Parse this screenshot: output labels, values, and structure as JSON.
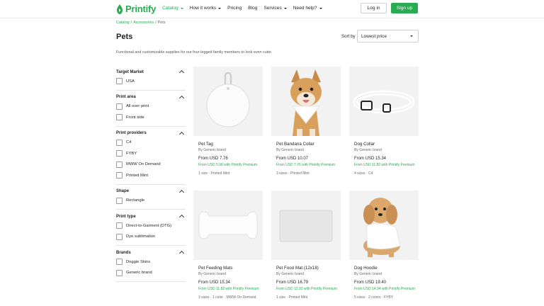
{
  "header": {
    "logo_text": "Printify",
    "nav": [
      {
        "label": "Catalog",
        "has_caret": true,
        "active": true
      },
      {
        "label": "How it works",
        "has_caret": true,
        "active": false
      },
      {
        "label": "Pricing",
        "has_caret": false,
        "active": false
      },
      {
        "label": "Blog",
        "has_caret": false,
        "active": false
      },
      {
        "label": "Services",
        "has_caret": true,
        "active": false
      },
      {
        "label": "Need help?",
        "has_caret": true,
        "active": false
      }
    ],
    "login_label": "Log in",
    "signup_label": "Sign up"
  },
  "breadcrumb": {
    "items": [
      "Catalog",
      "Accessories",
      "Pets"
    ],
    "separator": "/"
  },
  "page": {
    "title": "Pets",
    "description": "Functional and customizable supplies for our four-legged family members to look even cuter.",
    "sort_label": "Sort by",
    "sort_value": "Lowest price"
  },
  "filters": [
    {
      "title": "Target Market",
      "options": [
        "USA"
      ]
    },
    {
      "title": "Print area",
      "options": [
        "All over print",
        "Front side"
      ]
    },
    {
      "title": "Print providers",
      "options": [
        "C4",
        "FYBY",
        "MWW On Demand",
        "Printed Mint"
      ]
    },
    {
      "title": "Shape",
      "options": [
        "Rectangle"
      ]
    },
    {
      "title": "Print type",
      "options": [
        "Direct-to-Garment (DTG)",
        "Dye sublimation"
      ]
    },
    {
      "title": "Brands",
      "options": [
        "Doggie Skins",
        "Generic brand"
      ]
    }
  ],
  "products": [
    {
      "name": "Pet Tag",
      "brand": "By Generic brand",
      "price": "From USD 7.76",
      "premium": "From USD 5.98 with Printify Premium",
      "meta": "1 size · Printed Mint",
      "image_icon": "pet-tag"
    },
    {
      "name": "Pet Bandana Collar",
      "brand": "By Generic brand",
      "price": "From USD 10.07",
      "premium": "From USD 7.76 with Printify Premium",
      "meta": "3 sizes · Printed Mint",
      "image_icon": "dog-bandana"
    },
    {
      "name": "Dog Collar",
      "brand": "By Generic brand",
      "price": "From USD 15.34",
      "premium": "From USD 11.82 with Printify Premium",
      "meta": "4 sizes · C4",
      "image_icon": "dog-collar"
    },
    {
      "name": "Pet Feeding Mats",
      "brand": "By Generic brand",
      "price": "From USD 15.34",
      "premium": "From USD 11.82 with Printify Premium",
      "meta": "3 sizes · 1 color · MWW On Demand",
      "image_icon": "bone-mat"
    },
    {
      "name": "Pet Food Mat (12x18)",
      "brand": "By Generic brand",
      "price": "From USD 16.79",
      "premium": "From USD 12.93 with Printify Premium",
      "meta": "1 size · Printed Mint",
      "image_icon": "food-mat"
    },
    {
      "name": "Dog Hoodie",
      "brand": "By Generic brand",
      "price": "From USD 19.40",
      "premium": "From USD 14.94 with Printify Premium",
      "meta": "5 sizes · 2 colors · FYBY",
      "image_icon": "dog-hoodie"
    }
  ],
  "colors": {
    "accent": "#29ab51",
    "text": "#1f1f1f",
    "muted": "#6b6b6b",
    "image_bg": "#f2f2f2"
  }
}
